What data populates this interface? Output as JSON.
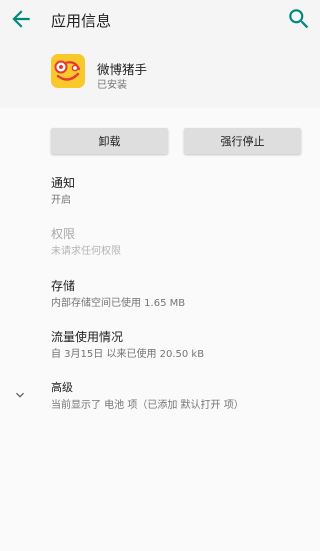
{
  "colors": {
    "accent": "#00897b",
    "text_primary": "#212121",
    "text_secondary": "#757575",
    "header_bg": "#f5f5f5"
  },
  "appbar": {
    "title": "应用信息",
    "back_icon": "arrow-back-icon",
    "search_icon": "search-icon"
  },
  "app": {
    "name": "微博猪手",
    "status": "已安装"
  },
  "buttons": {
    "uninstall": "卸载",
    "force_stop": "强行停止"
  },
  "rows": {
    "notifications": {
      "title": "通知",
      "subtitle": "开启"
    },
    "permissions": {
      "title": "权限",
      "subtitle": "未请求任何权限"
    },
    "storage": {
      "title": "存储",
      "subtitle": "内部存储空间已使用 1.65 MB"
    },
    "data_usage": {
      "title": "流量使用情况",
      "subtitle": "自 3月15日 以来已使用 20.50 kB"
    },
    "advanced": {
      "title": "高级",
      "subtitle": "当前显示了 电池 项（已添加 默认打开 项）",
      "icon": "chevron-down-icon"
    }
  }
}
